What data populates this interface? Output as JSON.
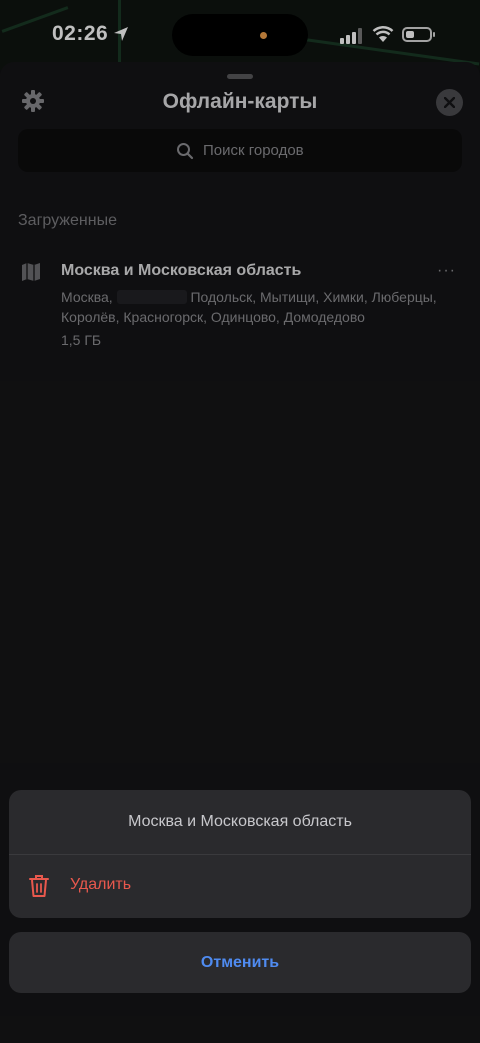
{
  "status_bar": {
    "time": "02:26",
    "icons": [
      "location-arrow-icon",
      "cellular-signal-icon",
      "wifi-icon",
      "battery-icon"
    ]
  },
  "sheet": {
    "title": "Офлайн-карты",
    "icons": [
      "settings-gear-icon",
      "close-icon"
    ],
    "search": {
      "placeholder": "Поиск городов",
      "icon": "search-icon"
    },
    "section_label": "Загруженные",
    "item": {
      "icon": "map-icon",
      "title": "Москва и Московская область",
      "cities_before_redaction": "Москва,",
      "cities_after_redaction": "Подольск, Мытищи, Химки, Люберцы, Королёв, Красногорск, Одинцово, Домодедово",
      "size": "1,5 ГБ",
      "more_label": "···"
    }
  },
  "action_sheet": {
    "title": "Москва и Московская область",
    "delete_label": "Удалить",
    "delete_icon": "trash-icon",
    "cancel_label": "Отменить"
  },
  "colors": {
    "accent_blue": "#4f8bf0",
    "destructive_red": "#e9584d",
    "background": "#151517"
  }
}
